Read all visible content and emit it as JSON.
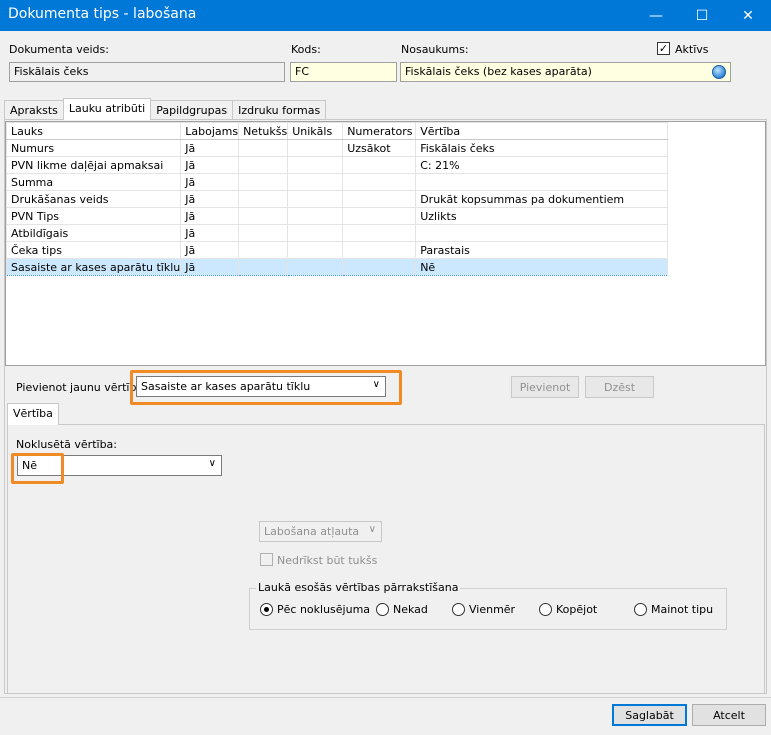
{
  "window": {
    "title": "Dokumenta tips - labošana",
    "minimize": "—",
    "maximize": "☐",
    "close": "✕"
  },
  "header": {
    "doc_type_label": "Dokumenta veids:",
    "doc_type_value": "Fiskālais čeks",
    "code_label": "Kods:",
    "code_value": "FC",
    "name_label": "Nosaukums:",
    "name_value": "Fiskālais čeks (bez kases aparāta)",
    "active_label": "Aktīvs",
    "active_checked": true
  },
  "tabs": [
    "Apraksts",
    "Lauku atribūti",
    "Papildgrupas",
    "Izdruku formas"
  ],
  "grid": {
    "columns": [
      "Lauks",
      "Labojams",
      "Netukšs",
      "Unikāls",
      "Numerators",
      "Vērtība"
    ],
    "rows": [
      [
        "Numurs",
        "Jā",
        "",
        "",
        "Uzsākot",
        "Fiskālais čeks"
      ],
      [
        "PVN likme daļējai apmaksai",
        "Jā",
        "",
        "",
        "",
        "C: 21%"
      ],
      [
        "Summa",
        "Jā",
        "",
        "",
        "",
        ""
      ],
      [
        "Drukāšanas veids",
        "Jā",
        "",
        "",
        "",
        "Drukāt kopsummas pa dokumentiem"
      ],
      [
        "PVN Tips",
        "Jā",
        "",
        "",
        "",
        "Uzlikts"
      ],
      [
        "Atbildīgais",
        "Jā",
        "",
        "",
        "",
        ""
      ],
      [
        "Čeka tips",
        "Jā",
        "",
        "",
        "",
        "Parastais"
      ],
      [
        "Sasaiste ar kases aparātu tīklu",
        "Jā",
        "",
        "",
        "",
        "Nē"
      ]
    ],
    "selected_row": 7
  },
  "add_value": {
    "label": "Pievienot jaunu vērtību:",
    "selected": "Sasaiste ar kases aparātu tīklu",
    "add_button": "Pievienot",
    "delete_button": "Dzēst"
  },
  "value_tab": "Vērtība",
  "value_panel": {
    "default_label": "Noklusētā vērtība:",
    "default_value": "Nē",
    "edit_combo": "Labošana atļauta",
    "not_empty_label": "Nedrīkst būt tukšs",
    "group_title": "Laukā esošās vērtības pārrakstīšana",
    "radios": [
      "Pēc noklusējuma",
      "Nekad",
      "Vienmēr",
      "Kopējot",
      "Mainot tipu"
    ],
    "radio_selected": 0
  },
  "footer": {
    "save": "Saglabāt",
    "cancel": "Atcelt"
  },
  "colors": {
    "titlebar": "#0078d7",
    "highlight": "#f08a24",
    "selection": "#cce8ff"
  }
}
